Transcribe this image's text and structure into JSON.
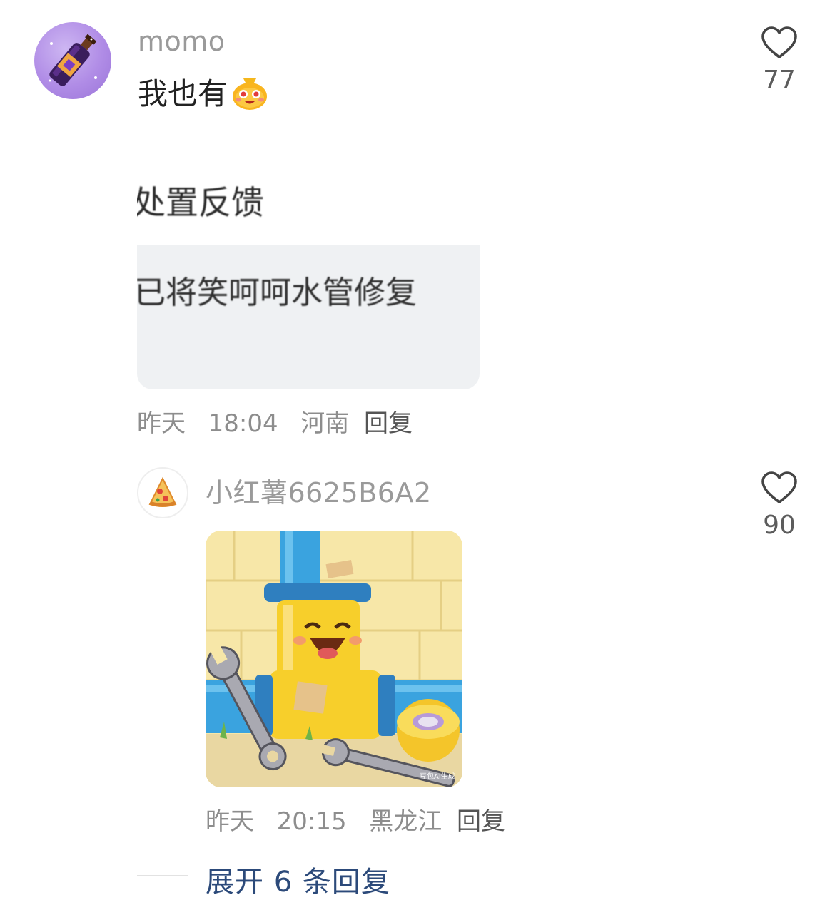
{
  "comment": {
    "username": "momo",
    "text": "我也有",
    "emoji_icon": "money-bag-face-emoji",
    "like_count": "77",
    "image": {
      "line1": "处置反馈",
      "line2": "已将笑呵呵水管修复"
    },
    "meta": {
      "date": "昨天",
      "time": "18:04",
      "location": "河南",
      "reply_label": "回复"
    }
  },
  "reply": {
    "username": "小红薯6625B6A2",
    "like_count": "90",
    "image_icon": "smiling-pipe-illustration",
    "image_watermark": "豆包AI生成",
    "meta": {
      "date": "昨天",
      "time": "20:15",
      "location": "黑龙江",
      "reply_label": "回复"
    }
  },
  "expand_replies": "展开 6 条回复",
  "colors": {
    "username": "#9a9a9a",
    "meta": "#8d8d8d",
    "expand_link": "#2c4a7a",
    "pipe_blue": "#3aa3df",
    "pipe_yellow": "#f7cf2b"
  }
}
